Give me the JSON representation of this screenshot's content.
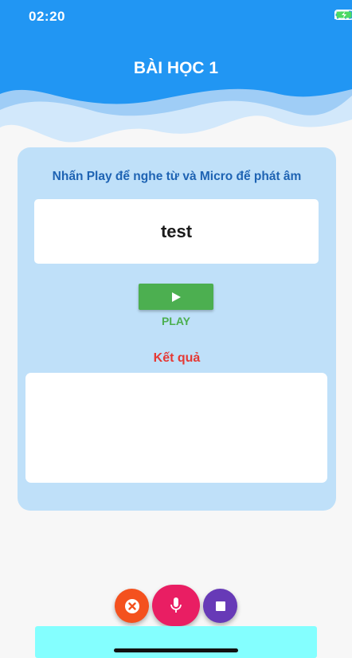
{
  "status_bar": {
    "time": "02:20"
  },
  "header": {
    "title": "BÀI HỌC 1"
  },
  "card": {
    "instruction": "Nhấn Play để nghe từ và Micro để phát âm",
    "word": "test",
    "play_label": "PLAY",
    "result_label": "Kết quả",
    "result_text": ""
  },
  "icons": {
    "signal": "signal-icon",
    "wifi": "wifi-icon",
    "battery": "battery-charging-icon",
    "play": "play-icon",
    "cancel": "close-icon",
    "mic": "microphone-icon",
    "stop": "stop-icon"
  },
  "colors": {
    "header_blue": "#2196f3",
    "card_bg": "#bfe0f9",
    "instruction_text": "#1e63b3",
    "play_green": "#4caf50",
    "result_red": "#e53935",
    "fab_cancel": "#f4511e",
    "fab_mic": "#e91e63",
    "fab_stop": "#673ab7",
    "bottom_bar": "#84ffff"
  }
}
